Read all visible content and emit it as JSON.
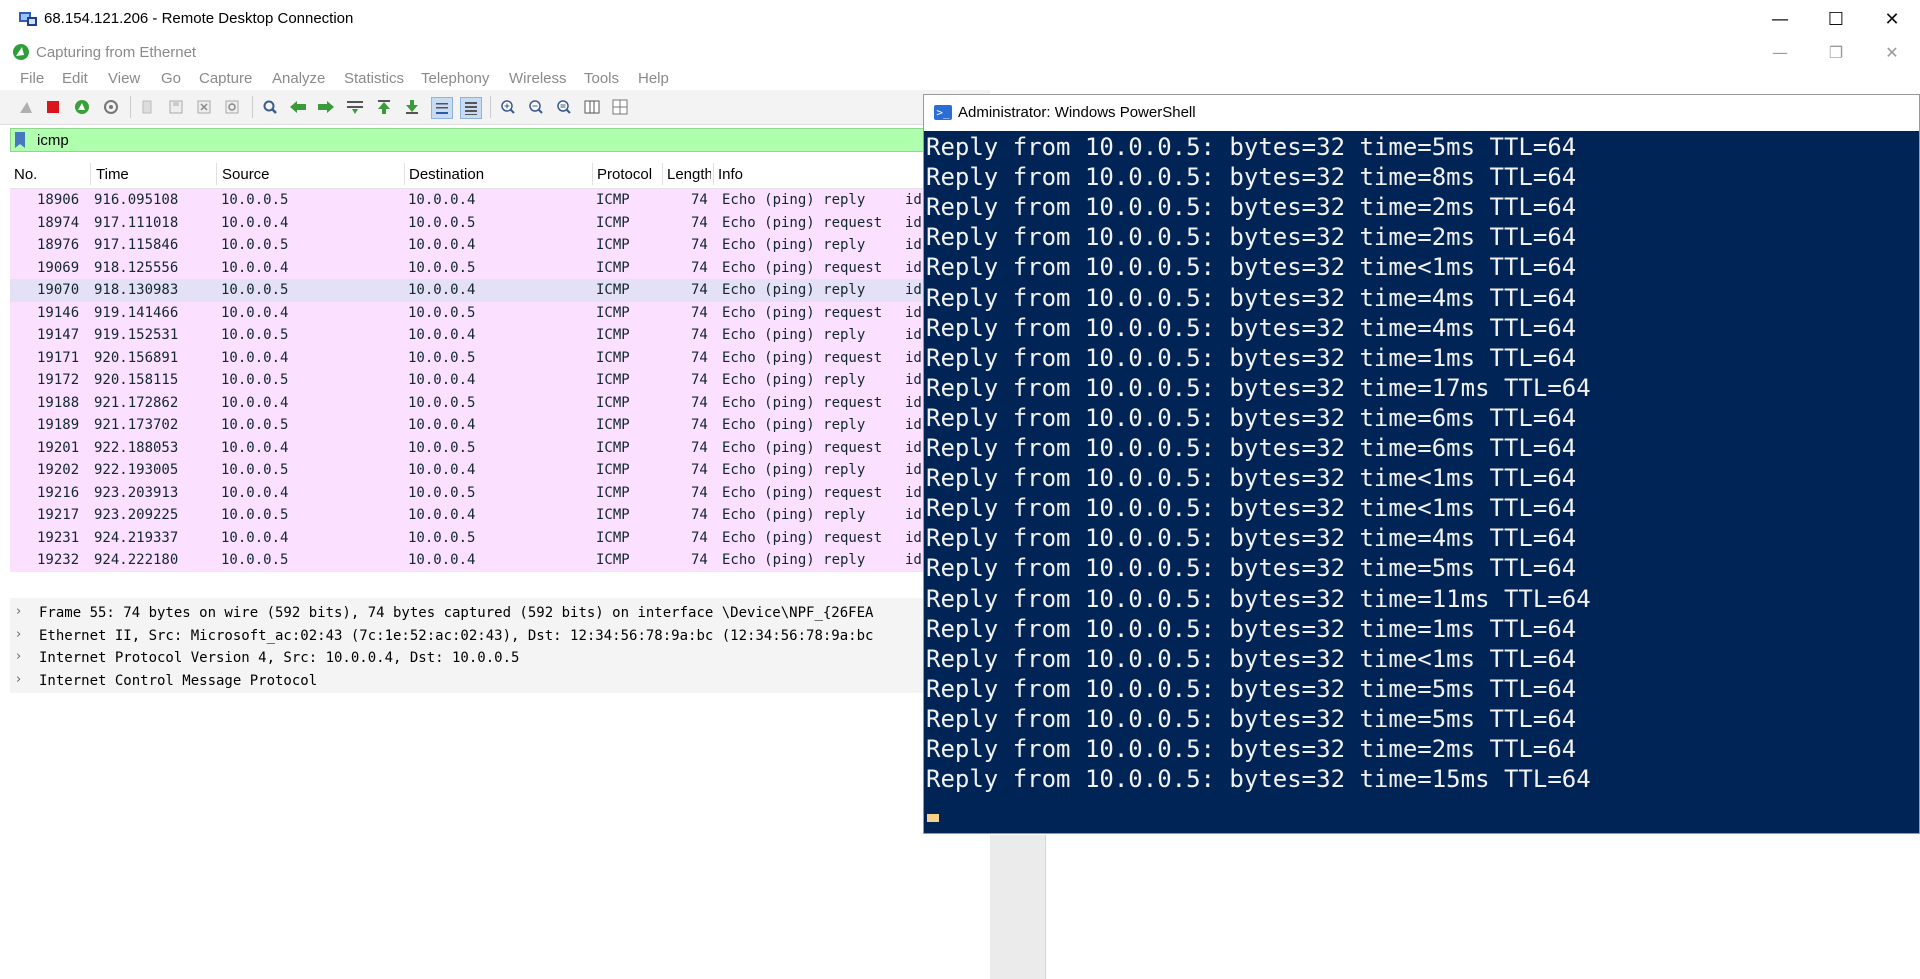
{
  "rdp": {
    "title": "68.154.121.206 - Remote Desktop Connection",
    "controls": {
      "minimize": "—",
      "maximize": "☐",
      "close": "✕"
    }
  },
  "wireshark": {
    "title": "Capturing from Ethernet",
    "controls": {
      "minimize": "—",
      "restore": "❐",
      "close": "✕"
    },
    "menu": [
      "File",
      "Edit",
      "View",
      "Go",
      "Capture",
      "Analyze",
      "Statistics",
      "Telephony",
      "Wireless",
      "Tools",
      "Help"
    ],
    "toolbar_icons": [
      "shark-fin-start-icon",
      "stop-capture-icon",
      "restart-capture-icon",
      "capture-options-icon",
      "open-file-icon",
      "save-file-icon",
      "close-file-icon",
      "reload-file-icon",
      "find-packet-icon",
      "go-back-icon",
      "go-forward-icon",
      "go-to-packet-icon",
      "go-first-icon",
      "go-last-icon",
      "autoscroll-icon",
      "colorize-icon",
      "zoom-in-icon",
      "zoom-out-icon",
      "zoom-normal-icon",
      "resize-columns-icon",
      "layout-icon"
    ],
    "filter": {
      "value": "icmp"
    },
    "columns": {
      "no": "No.",
      "time": "Time",
      "source": "Source",
      "destination": "Destination",
      "protocol": "Protocol",
      "length": "Length",
      "info": "Info"
    },
    "packets": [
      {
        "no": "18906",
        "time": "916.095108",
        "src": "10.0.0.5",
        "dst": "10.0.0.4",
        "proto": "ICMP",
        "len": "74",
        "info": "Echo (ping) reply",
        "extra": "id"
      },
      {
        "no": "18974",
        "time": "917.111018",
        "src": "10.0.0.4",
        "dst": "10.0.0.5",
        "proto": "ICMP",
        "len": "74",
        "info": "Echo (ping) request",
        "extra": "id"
      },
      {
        "no": "18976",
        "time": "917.115846",
        "src": "10.0.0.5",
        "dst": "10.0.0.4",
        "proto": "ICMP",
        "len": "74",
        "info": "Echo (ping) reply",
        "extra": "id"
      },
      {
        "no": "19069",
        "time": "918.125556",
        "src": "10.0.0.4",
        "dst": "10.0.0.5",
        "proto": "ICMP",
        "len": "74",
        "info": "Echo (ping) request",
        "extra": "id"
      },
      {
        "no": "19070",
        "time": "918.130983",
        "src": "10.0.0.5",
        "dst": "10.0.0.4",
        "proto": "ICMP",
        "len": "74",
        "info": "Echo (ping) reply",
        "extra": "id"
      },
      {
        "no": "19146",
        "time": "919.141466",
        "src": "10.0.0.4",
        "dst": "10.0.0.5",
        "proto": "ICMP",
        "len": "74",
        "info": "Echo (ping) request",
        "extra": "id"
      },
      {
        "no": "19147",
        "time": "919.152531",
        "src": "10.0.0.5",
        "dst": "10.0.0.4",
        "proto": "ICMP",
        "len": "74",
        "info": "Echo (ping) reply",
        "extra": "id"
      },
      {
        "no": "19171",
        "time": "920.156891",
        "src": "10.0.0.4",
        "dst": "10.0.0.5",
        "proto": "ICMP",
        "len": "74",
        "info": "Echo (ping) request",
        "extra": "id"
      },
      {
        "no": "19172",
        "time": "920.158115",
        "src": "10.0.0.5",
        "dst": "10.0.0.4",
        "proto": "ICMP",
        "len": "74",
        "info": "Echo (ping) reply",
        "extra": "id"
      },
      {
        "no": "19188",
        "time": "921.172862",
        "src": "10.0.0.4",
        "dst": "10.0.0.5",
        "proto": "ICMP",
        "len": "74",
        "info": "Echo (ping) request",
        "extra": "id"
      },
      {
        "no": "19189",
        "time": "921.173702",
        "src": "10.0.0.5",
        "dst": "10.0.0.4",
        "proto": "ICMP",
        "len": "74",
        "info": "Echo (ping) reply",
        "extra": "id"
      },
      {
        "no": "19201",
        "time": "922.188053",
        "src": "10.0.0.4",
        "dst": "10.0.0.5",
        "proto": "ICMP",
        "len": "74",
        "info": "Echo (ping) request",
        "extra": "id"
      },
      {
        "no": "19202",
        "time": "922.193005",
        "src": "10.0.0.5",
        "dst": "10.0.0.4",
        "proto": "ICMP",
        "len": "74",
        "info": "Echo (ping) reply",
        "extra": "id"
      },
      {
        "no": "19216",
        "time": "923.203913",
        "src": "10.0.0.4",
        "dst": "10.0.0.5",
        "proto": "ICMP",
        "len": "74",
        "info": "Echo (ping) request",
        "extra": "id"
      },
      {
        "no": "19217",
        "time": "923.209225",
        "src": "10.0.0.5",
        "dst": "10.0.0.4",
        "proto": "ICMP",
        "len": "74",
        "info": "Echo (ping) reply",
        "extra": "id"
      },
      {
        "no": "19231",
        "time": "924.219337",
        "src": "10.0.0.4",
        "dst": "10.0.0.5",
        "proto": "ICMP",
        "len": "74",
        "info": "Echo (ping) request",
        "extra": "id"
      },
      {
        "no": "19232",
        "time": "924.222180",
        "src": "10.0.0.5",
        "dst": "10.0.0.4",
        "proto": "ICMP",
        "len": "74",
        "info": "Echo (ping) reply",
        "extra": "id"
      }
    ],
    "selected_packet": "19070",
    "details": [
      "Frame 55: 74 bytes on wire (592 bits), 74 bytes captured (592 bits) on interface \\Device\\NPF_{26FEA",
      "Ethernet II, Src: Microsoft_ac:02:43 (7c:1e:52:ac:02:43), Dst: 12:34:56:78:9a:bc (12:34:56:78:9a:bc",
      "Internet Protocol Version 4, Src: 10.0.0.4, Dst: 10.0.0.5",
      "Internet Control Message Protocol"
    ],
    "row_colors": {
      "icmp": "#fce0ff",
      "selected": "#e4e0f6",
      "filter_valid": "#afffaf"
    }
  },
  "powershell": {
    "title": "Administrator: Windows PowerShell",
    "background": "#012456",
    "lines": [
      "Reply from 10.0.0.5: bytes=32 time=5ms TTL=64",
      "Reply from 10.0.0.5: bytes=32 time=8ms TTL=64",
      "Reply from 10.0.0.5: bytes=32 time=2ms TTL=64",
      "Reply from 10.0.0.5: bytes=32 time=2ms TTL=64",
      "Reply from 10.0.0.5: bytes=32 time<1ms TTL=64",
      "Reply from 10.0.0.5: bytes=32 time=4ms TTL=64",
      "Reply from 10.0.0.5: bytes=32 time=4ms TTL=64",
      "Reply from 10.0.0.5: bytes=32 time=1ms TTL=64",
      "Reply from 10.0.0.5: bytes=32 time=17ms TTL=64",
      "Reply from 10.0.0.5: bytes=32 time=6ms TTL=64",
      "Reply from 10.0.0.5: bytes=32 time=6ms TTL=64",
      "Reply from 10.0.0.5: bytes=32 time<1ms TTL=64",
      "Reply from 10.0.0.5: bytes=32 time<1ms TTL=64",
      "Reply from 10.0.0.5: bytes=32 time=4ms TTL=64",
      "Reply from 10.0.0.5: bytes=32 time=5ms TTL=64",
      "Reply from 10.0.0.5: bytes=32 time=11ms TTL=64",
      "Reply from 10.0.0.5: bytes=32 time=1ms TTL=64",
      "Reply from 10.0.0.5: bytes=32 time<1ms TTL=64",
      "Reply from 10.0.0.5: bytes=32 time=5ms TTL=64",
      "Reply from 10.0.0.5: bytes=32 time=5ms TTL=64",
      "Reply from 10.0.0.5: bytes=32 time=2ms TTL=64",
      "Reply from 10.0.0.5: bytes=32 time=15ms TTL=64"
    ]
  }
}
